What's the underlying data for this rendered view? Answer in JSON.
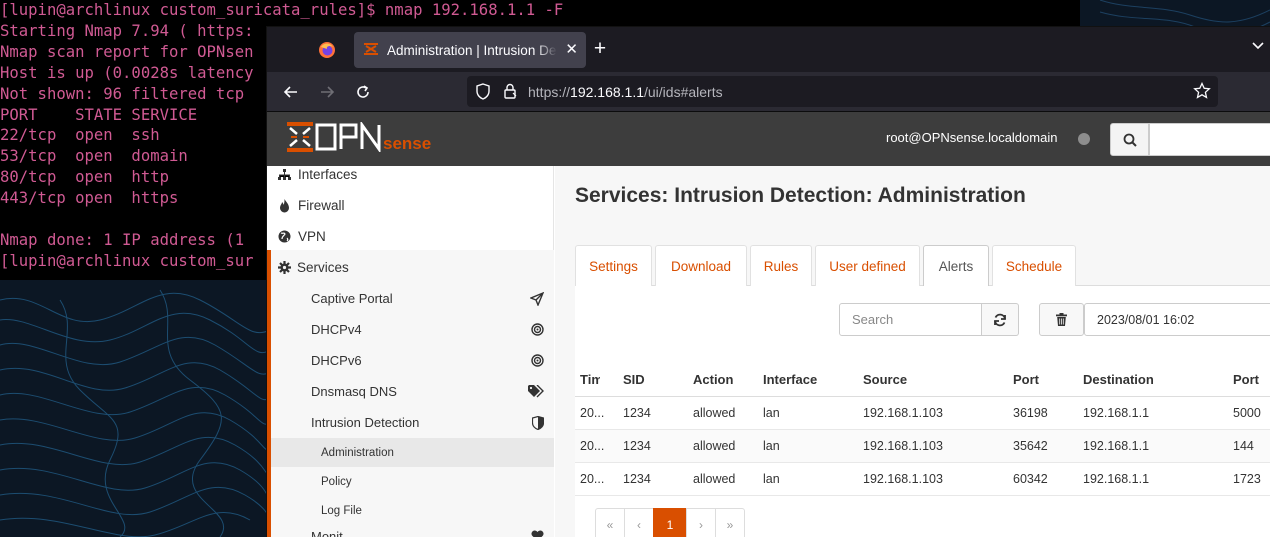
{
  "terminal": {
    "lines": [
      "[lupin@archlinux custom_suricata_rules]$ nmap 192.168.1.1 -F",
      "Starting Nmap 7.94 ( https:",
      "Nmap scan report for OPNsen",
      "Host is up (0.0028s latency",
      "Not shown: 96 filtered tcp ",
      "PORT    STATE SERVICE",
      "22/tcp  open  ssh",
      "53/tcp  open  domain",
      "80/tcp  open  http",
      "443/tcp open  https",
      "",
      "Nmap done: 1 IP address (1 ",
      "[lupin@archlinux custom_sur"
    ]
  },
  "browser": {
    "tab_title": "Administration | Intrusion Detection",
    "url_prefix": "https://",
    "url_host": "192.168.1.1",
    "url_path": "/ui/ids#alerts"
  },
  "header": {
    "user": "root@OPNsense.localdomain",
    "logo_text": "OPNsense"
  },
  "sidebar": {
    "interfaces": "Interfaces",
    "firewall": "Firewall",
    "vpn": "VPN",
    "services": "Services",
    "sub": [
      {
        "label": "Captive Portal",
        "icon": "paper-plane-icon"
      },
      {
        "label": "DHCPv4",
        "icon": "bullseye-icon"
      },
      {
        "label": "DHCPv6",
        "icon": "bullseye-icon"
      },
      {
        "label": "Dnsmasq DNS",
        "icon": "tags-icon"
      },
      {
        "label": "Intrusion Detection",
        "icon": "shield-icon"
      }
    ],
    "ids_sub": [
      "Administration",
      "Policy",
      "Log File"
    ],
    "partial_next": "Monit"
  },
  "content": {
    "title": "Services: Intrusion Detection: Administration",
    "tabs": [
      "Settings",
      "Download",
      "Rules",
      "User defined",
      "Alerts",
      "Schedule"
    ],
    "active_tab": "Alerts",
    "search_placeholder": "Search",
    "date_value": "2023/08/01 16:02",
    "columns": [
      "Timestamp",
      "SID",
      "Action",
      "Interface",
      "Source",
      "Port",
      "Destination",
      "Port"
    ],
    "rows": [
      [
        "20...",
        "1234",
        "allowed",
        "lan",
        "192.168.1.103",
        "36198",
        "192.168.1.1",
        "5000"
      ],
      [
        "20...",
        "1234",
        "allowed",
        "lan",
        "192.168.1.103",
        "35642",
        "192.168.1.1",
        "144"
      ],
      [
        "20...",
        "1234",
        "allowed",
        "lan",
        "192.168.1.103",
        "60342",
        "192.168.1.1",
        "1723"
      ]
    ],
    "pager": [
      "«",
      "‹",
      "1",
      "›",
      "»"
    ],
    "current_page": "1"
  },
  "colors": {
    "accent": "#d94f00",
    "terminal_text": "#d05a93"
  }
}
